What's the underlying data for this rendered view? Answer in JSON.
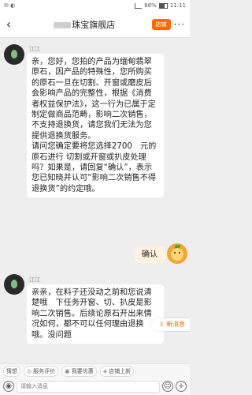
{
  "status_bar": {
    "time": "11:11",
    "battery": "68%"
  },
  "header": {
    "back_icon": "chevron-left-icon",
    "title": "珠宝旗舰店",
    "shop_button": "店铺",
    "more_icon": "more-icon"
  },
  "messages": [
    {
      "sender": "江江",
      "lines": [
        "亲，您好，您拍的产品为缅甸翡翠原石，因产品的特殊性，您所购买的原石一旦在切割、开窗或磨皮后会影响产品的完整性，根据《消费者权益保护法》，这一行为已属于定制定做商品范畴，影响二次销售，不支持退换货，请您我们无法为您提供退换货服务。",
        "请问您确定要将您选择2700　元的原石进行 切割或开窗或扒皮处理吗？如果是，请回复“确认”，表示您已知晓并认可“影响二次销售不得退换货”的约定哦。"
      ]
    },
    {
      "sender": "me",
      "lines": [
        "确认"
      ]
    },
    {
      "sender": "江江",
      "lines": [
        "亲亲，在料子还没动之前和您说清楚哦　下任务开窗、切、扒皮是影响二次销售。后续论原石开出来情况如何，都不可以任何理由退换哦。没问题"
      ]
    }
  ],
  "new_message_button": "新消息",
  "quick_bar": {
    "items": [
      "猜想",
      "服务评价",
      "我要优惠",
      "店铺上新"
    ]
  },
  "input": {
    "placeholder": "请输入消息"
  },
  "colors": {
    "accent": "#ff6a00",
    "background": "#eeeeee",
    "bubble_left": "#ffffff",
    "bubble_right": "#fff3df"
  }
}
